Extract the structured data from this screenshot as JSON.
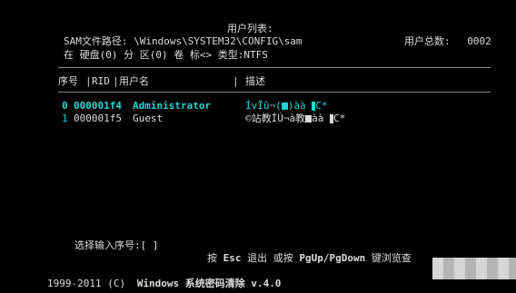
{
  "header": {
    "title": "用户列表:",
    "sam_path_label": "SAM文件路径:",
    "sam_path_value": "\\Windows\\SYSTEM32\\CONFIG\\sam",
    "user_count_label": "用户总数:",
    "user_count_value": "0002",
    "location_line": "在 硬盘(0) 分 区(0) 卷 标<> 类型:NTFS"
  },
  "table": {
    "columns": [
      "序号",
      "RID",
      "用户名",
      "描述"
    ],
    "rows": [
      {
        "index": "0",
        "rid": "000001f4",
        "username": "Administrator",
        "description_a": "ÍvÎû¬(",
        "description_b": ")àà ",
        "description_c": "C*"
      },
      {
        "index": "1",
        "rid": "000001f5",
        "username": "Guest",
        "description_a": "©站教ÍÚ¬à教",
        "description_b": "àà ",
        "description_c": "C*"
      }
    ]
  },
  "footer": {
    "prompt": "选择输入序号:[ ]",
    "hint_press": "按",
    "hint_esc": "Esc",
    "hint_exit": "退出  或按",
    "hint_keys": "PgUp/PgDown",
    "hint_browse": "键浏览查",
    "copyright_years": "1999-2011 (C)",
    "copyright_product": "Windows 系统密码清除 v.4.0"
  },
  "colors": {
    "background": "#000000",
    "text": "#dcdcdc",
    "highlight": "#21d6d6"
  }
}
